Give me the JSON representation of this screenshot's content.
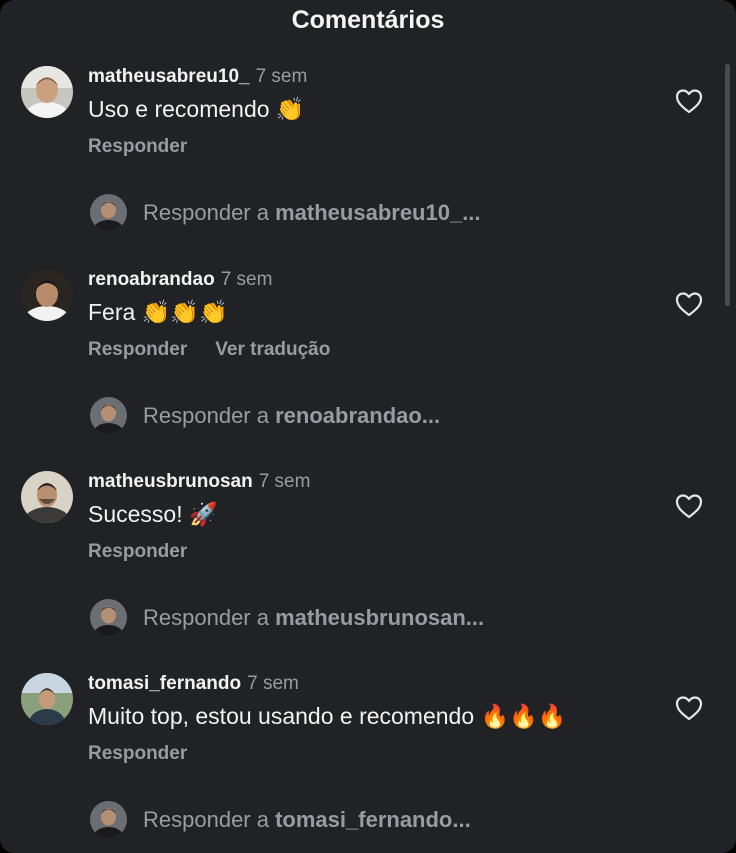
{
  "header": {
    "title": "Comentários"
  },
  "comments": [
    {
      "username": "matheusabreu10_",
      "time": "7 sem",
      "text": "Uso e recomendo 👏",
      "reply_label": "Responder",
      "reply_prefix": "Responder a",
      "reply_target": "matheusabreu10_...",
      "avatar_icon": "profile-photo-man-smiling"
    },
    {
      "username": "renoabrandao",
      "time": "7 sem",
      "text": "Fera 👏👏👏",
      "reply_label": "Responder",
      "translate_label": "Ver tradução",
      "reply_prefix": "Responder a",
      "reply_target": "renoabrandao...",
      "avatar_icon": "profile-photo-man-white-shirt"
    },
    {
      "username": "matheusbrunosan",
      "time": "7 sem",
      "text": "Sucesso! 🚀",
      "reply_label": "Responder",
      "reply_prefix": "Responder a",
      "reply_target": "matheusbrunosan...",
      "avatar_icon": "profile-photo-man-outdoors"
    },
    {
      "username": "tomasi_fernando",
      "time": "7 sem",
      "text": "Muito top, estou usando e recomendo 🔥🔥🔥",
      "reply_label": "Responder",
      "reply_prefix": "Responder a",
      "reply_target": "tomasi_fernando...",
      "avatar_icon": "profile-photo-man-nature"
    }
  ],
  "colors": {
    "background": "#212226",
    "primary_text": "#f2f2f2",
    "secondary_text": "#9a9ba0"
  },
  "icons": {
    "like": "heart-outline-icon",
    "current_user_avatar": "current-user-avatar"
  }
}
